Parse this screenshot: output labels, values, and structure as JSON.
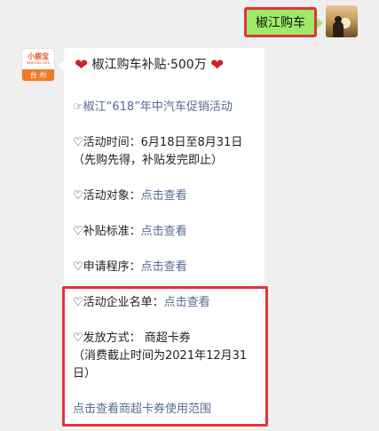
{
  "outgoing": {
    "text": "椒江购车"
  },
  "bot": {
    "logo_top": "小鹿宝",
    "logo_mid": "deerbao.com",
    "logo_bottom": "台 州"
  },
  "message": {
    "title_text": "椒江购车补贴·500万",
    "heart_left": "❤",
    "heart_right": "❤",
    "activity_link": "☞椒江“618”年中汽车促销活动",
    "time_label": "♡活动时间：6月18日至8月31日",
    "time_note": "（先购先得，补贴发完即止）",
    "target_label": "♡活动对象：",
    "target_link": "点击查看",
    "standard_label": "♡补贴标准：",
    "standard_link": "点击查看",
    "process_label": "♡申请程序：",
    "process_link": "点击查看",
    "companies_label": "♡活动企业名单：",
    "companies_link": "点击查看",
    "issue_label": "♡发放方式：  商超卡券",
    "issue_note_1": "（消费截止时间为2021年12月31",
    "issue_note_2": "日）",
    "scope_link": "点击查看商超卡券使用范围"
  }
}
